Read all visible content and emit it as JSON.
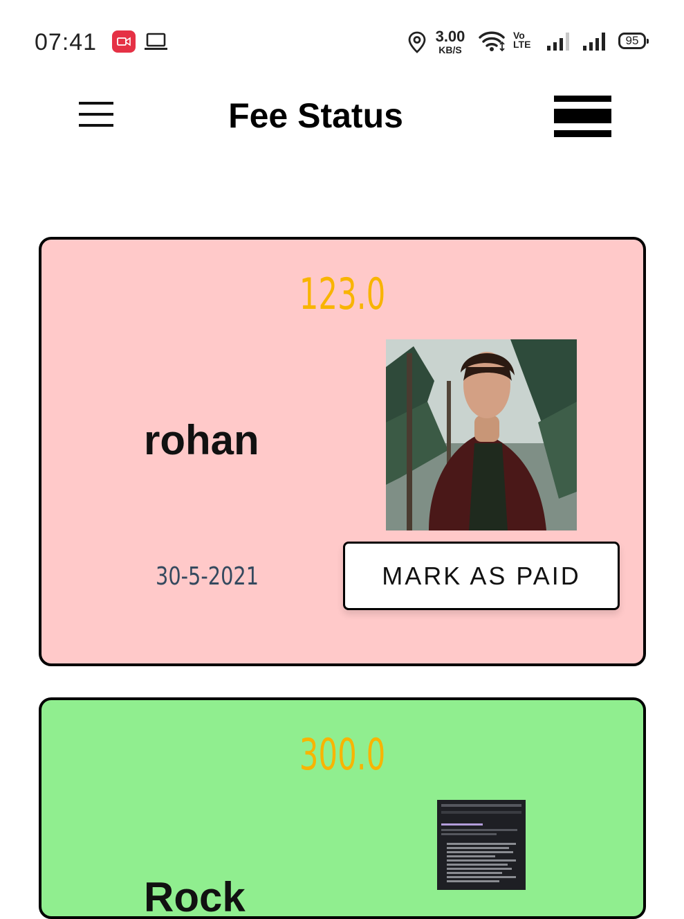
{
  "status_bar": {
    "time": "07:41",
    "network_speed_value": "3.00",
    "network_speed_unit": "KB/S",
    "volte_top": "Vo",
    "volte_bottom": "LTE",
    "battery": "95"
  },
  "app_bar": {
    "title": "Fee Status"
  },
  "cards": [
    {
      "amount": "123.0",
      "name": "rohan",
      "date": "30-5-2021",
      "button_label": "MARK AS PAID",
      "background": "#ffc9c9"
    },
    {
      "amount": "300.0",
      "name": "Rock",
      "background": "#90ee8f"
    }
  ],
  "colors": {
    "amount_text": "#f8b400",
    "date_text": "#34495e",
    "record_icon": "#e53145"
  }
}
